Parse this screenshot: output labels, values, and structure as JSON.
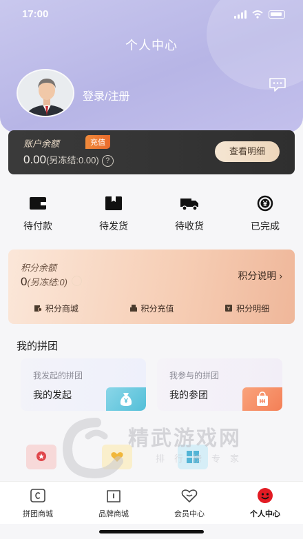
{
  "status_bar": {
    "time": "17:00"
  },
  "header": {
    "title": "个人中心",
    "login_text": "登录/注册"
  },
  "account": {
    "label": "账户余额",
    "recharge_badge": "充值",
    "balance": "0.00",
    "frozen": "(另冻结:0.00)",
    "help_symbol": "?",
    "detail_button": "查看明细"
  },
  "orders": [
    {
      "label": "待付款",
      "icon": "wallet-icon"
    },
    {
      "label": "待发货",
      "icon": "package-icon"
    },
    {
      "label": "待收货",
      "icon": "truck-icon"
    },
    {
      "label": "已完成",
      "icon": "yen-circle-icon"
    }
  ],
  "points": {
    "label": "积分余额",
    "value": "0",
    "frozen": "(另冻结:0)",
    "explain": "积分说明 ›",
    "links": [
      {
        "label": "积分商城",
        "icon": "mall-icon"
      },
      {
        "label": "积分充值",
        "icon": "recharge-icon"
      },
      {
        "label": "积分明细",
        "icon": "detail-icon"
      }
    ]
  },
  "group": {
    "title": "我的拼团",
    "cards": [
      {
        "sub": "我发起的拼团",
        "main": "我的发起",
        "icon": "money-bag-icon"
      },
      {
        "sub": "我参与的拼团",
        "main": "我的参团",
        "icon": "shopping-bag-icon"
      }
    ]
  },
  "watermark": {
    "text": "精武游戏网",
    "sub": "排行榜专家"
  },
  "tabbar": [
    {
      "label": "拼团商城",
      "icon": "group-mall-icon",
      "active": false
    },
    {
      "label": "品牌商城",
      "icon": "brand-mall-icon",
      "active": false
    },
    {
      "label": "会员中心",
      "icon": "member-icon",
      "active": false
    },
    {
      "label": "个人中心",
      "icon": "profile-icon",
      "active": true
    }
  ],
  "colors": {
    "header": "#b7b5e6",
    "badge": "#e96b2c",
    "active_tab": "#e21b23",
    "tile_blue": "#53bfd8",
    "tile_orange": "#f47f56"
  }
}
